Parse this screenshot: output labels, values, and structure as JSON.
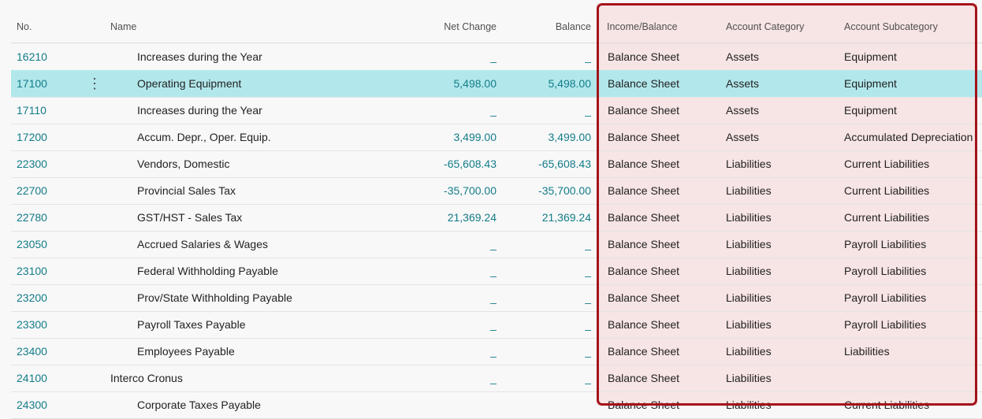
{
  "columns": {
    "no": "No.",
    "name": "Name",
    "net_change": "Net Change",
    "balance": "Balance",
    "income_balance": "Income/Balance",
    "account_category": "Account Category",
    "account_subcategory": "Account Subcategory"
  },
  "colors": {
    "link": "#137c87",
    "selected_row": "#b2e8ec",
    "highlight_border": "#a4131a",
    "highlight_fill": "#f7e4e4"
  },
  "row_menu_icon": "vertical-ellipsis-icon",
  "row_menu_glyph": "⋮",
  "rows": [
    {
      "no": "16210",
      "name": "Increases during the Year",
      "indent": true,
      "net": "_",
      "bal": "_",
      "ib": "Balance Sheet",
      "cat": "Assets",
      "sub": "Equipment"
    },
    {
      "no": "17100",
      "name": "Operating Equipment",
      "indent": true,
      "net": "5,498.00",
      "bal": "5,498.00",
      "ib": "Balance Sheet",
      "cat": "Assets",
      "sub": "Equipment",
      "selected": true
    },
    {
      "no": "17110",
      "name": "Increases during the Year",
      "indent": true,
      "net": "_",
      "bal": "_",
      "ib": "Balance Sheet",
      "cat": "Assets",
      "sub": "Equipment"
    },
    {
      "no": "17200",
      "name": "Accum. Depr., Oper. Equip.",
      "indent": true,
      "net": "3,499.00",
      "bal": "3,499.00",
      "ib": "Balance Sheet",
      "cat": "Assets",
      "sub": "Accumulated Depreciation"
    },
    {
      "no": "22300",
      "name": "Vendors, Domestic",
      "indent": true,
      "net": "-65,608.43",
      "bal": "-65,608.43",
      "ib": "Balance Sheet",
      "cat": "Liabilities",
      "sub": "Current Liabilities"
    },
    {
      "no": "22700",
      "name": "Provincial Sales Tax",
      "indent": true,
      "net": "-35,700.00",
      "bal": "-35,700.00",
      "ib": "Balance Sheet",
      "cat": "Liabilities",
      "sub": "Current Liabilities"
    },
    {
      "no": "22780",
      "name": "GST/HST - Sales Tax",
      "indent": true,
      "net": "21,369.24",
      "bal": "21,369.24",
      "ib": "Balance Sheet",
      "cat": "Liabilities",
      "sub": "Current Liabilities"
    },
    {
      "no": "23050",
      "name": "Accrued Salaries & Wages",
      "indent": true,
      "net": "_",
      "bal": "_",
      "ib": "Balance Sheet",
      "cat": "Liabilities",
      "sub": "Payroll Liabilities"
    },
    {
      "no": "23100",
      "name": "Federal Withholding Payable",
      "indent": true,
      "net": "_",
      "bal": "_",
      "ib": "Balance Sheet",
      "cat": "Liabilities",
      "sub": "Payroll Liabilities"
    },
    {
      "no": "23200",
      "name": "Prov/State Withholding Payable",
      "indent": true,
      "net": "_",
      "bal": "_",
      "ib": "Balance Sheet",
      "cat": "Liabilities",
      "sub": "Payroll Liabilities"
    },
    {
      "no": "23300",
      "name": "Payroll Taxes Payable",
      "indent": true,
      "net": "_",
      "bal": "_",
      "ib": "Balance Sheet",
      "cat": "Liabilities",
      "sub": "Payroll Liabilities"
    },
    {
      "no": "23400",
      "name": "Employees Payable",
      "indent": true,
      "net": "_",
      "bal": "_",
      "ib": "Balance Sheet",
      "cat": "Liabilities",
      "sub": "Liabilities"
    },
    {
      "no": "24100",
      "name": "Interco Cronus",
      "indent": false,
      "net": "_",
      "bal": "_",
      "ib": "Balance Sheet",
      "cat": "Liabilities",
      "sub": ""
    },
    {
      "no": "24300",
      "name": "Corporate Taxes Payable",
      "indent": true,
      "net": "",
      "bal": "",
      "ib": "Balance Sheet",
      "cat": "Liabilities",
      "sub": "Current Liabilities"
    }
  ]
}
